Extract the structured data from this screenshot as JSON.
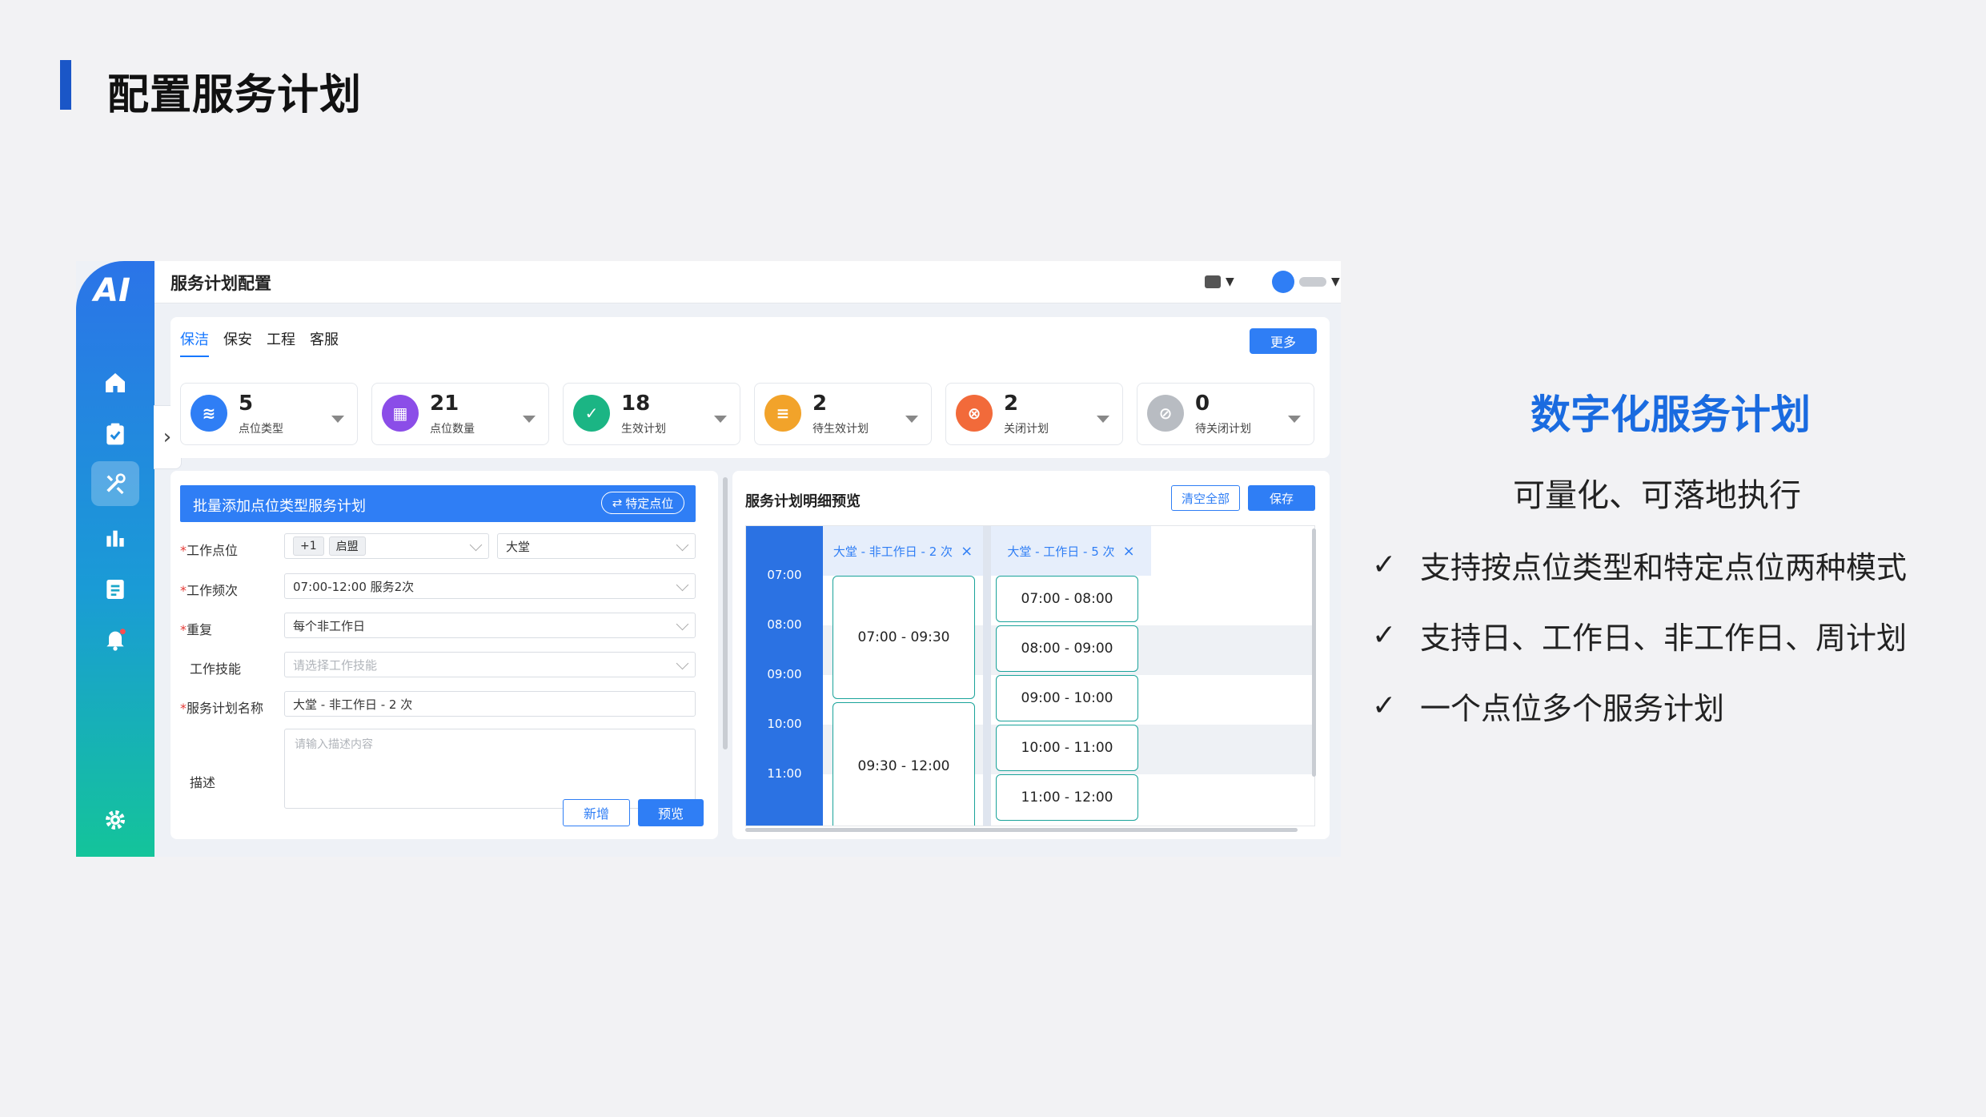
{
  "slide": {
    "title": "配置服务计划"
  },
  "app": {
    "logo_text": "AI",
    "title": "服务计划配置",
    "sidebar_icons": [
      "home-icon",
      "clipboard-check-icon",
      "tools-icon",
      "bar-chart-icon",
      "list-icon",
      "bell-icon",
      "gear-icon"
    ],
    "tabs": [
      {
        "label": "保洁",
        "active": true
      },
      {
        "label": "保安",
        "active": false
      },
      {
        "label": "工程",
        "active": false
      },
      {
        "label": "客服",
        "active": false
      }
    ],
    "more_button": "更多",
    "stats": [
      {
        "value": "5",
        "label": "点位类型",
        "color": "#2f7ef5"
      },
      {
        "value": "21",
        "label": "点位数量",
        "color": "#8b4de8"
      },
      {
        "value": "18",
        "label": "生效计划",
        "color": "#1bb584"
      },
      {
        "value": "2",
        "label": "待生效计划",
        "color": "#f2a32a"
      },
      {
        "value": "2",
        "label": "关闭计划",
        "color": "#f26a3a"
      },
      {
        "value": "0",
        "label": "待关闭计划",
        "color": "#b8bcc2"
      }
    ],
    "form": {
      "header": "批量添加点位类型服务计划",
      "specific_button": "特定点位",
      "labels": {
        "location": "工作点位",
        "frequency": "工作频次",
        "repeat": "重复",
        "skill": "工作技能",
        "plan_name": "服务计划名称",
        "description": "描述"
      },
      "location_chip_count": "+1",
      "location_chip": "启盟",
      "location_area": "大堂",
      "frequency_value": "07:00-12:00 服务2次",
      "repeat_value": "每个非工作日",
      "skill_placeholder": "请选择工作技能",
      "plan_name_value": "大堂 - 非工作日 - 2 次",
      "description_placeholder": "请输入描述内容",
      "add_button": "新增",
      "preview_button": "预览"
    },
    "preview": {
      "title": "服务计划明细预览",
      "clear_button": "清空全部",
      "save_button": "保存",
      "times": [
        "07:00",
        "08:00",
        "09:00",
        "10:00",
        "11:00"
      ],
      "columns": [
        {
          "label": "大堂 - 非工作日 - 2 次",
          "slots": [
            "07:00 - 09:30",
            "09:30 - 12:00"
          ]
        },
        {
          "label": "大堂 - 工作日 - 5 次",
          "slots": [
            "07:00 - 08:00",
            "08:00 - 09:00",
            "09:00 - 10:00",
            "10:00 - 11:00",
            "11:00 - 12:00"
          ]
        }
      ]
    }
  },
  "highlight": {
    "title": "数字化服务计划",
    "subtitle": "可量化、可落地执行",
    "check": "✓",
    "features": [
      "支持按点位类型和特定点位两种模式",
      "支持日、工作日、非工作日、周计划",
      "一个点位多个服务计划"
    ]
  }
}
